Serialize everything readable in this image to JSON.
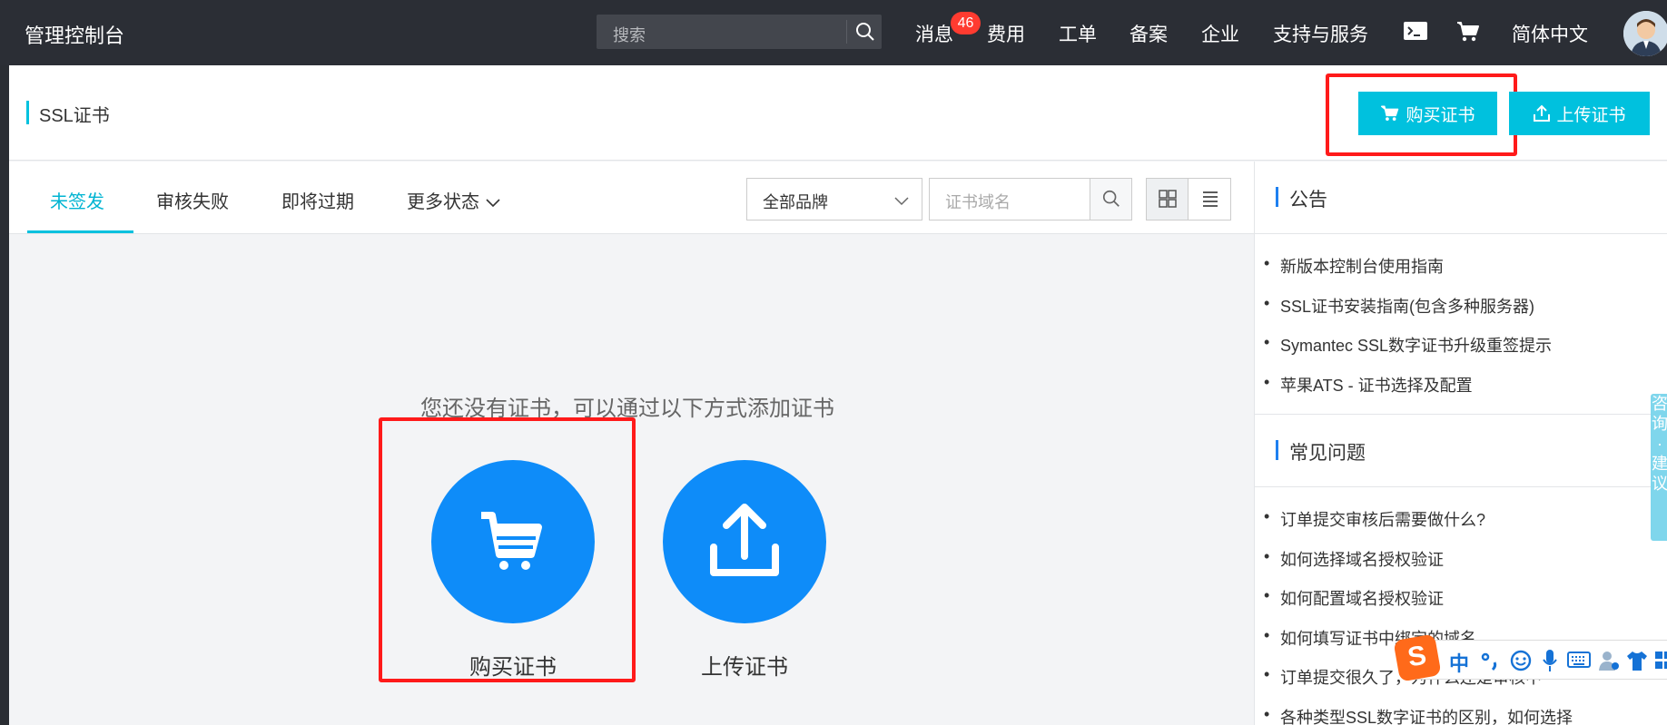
{
  "topbar": {
    "brand": "管理控制台",
    "search_placeholder": "搜索",
    "nav": [
      "消息",
      "费用",
      "工单",
      "备案",
      "企业",
      "支持与服务"
    ],
    "message_badge": "46",
    "language": "简体中文"
  },
  "header": {
    "title": "SSL证书",
    "buy_button": "购买证书",
    "upload_button": "上传证书"
  },
  "tabs": [
    {
      "label": "未签发",
      "active": true
    },
    {
      "label": "审核失败",
      "active": false
    },
    {
      "label": "即将过期",
      "active": false
    },
    {
      "label": "更多状态",
      "active": false
    }
  ],
  "filters": {
    "brand_select": "全部品牌",
    "domain_placeholder": "证书域名"
  },
  "empty_state": {
    "message": "您还没有证书，可以通过以下方式添加证书",
    "buy_label": "购买证书",
    "upload_label": "上传证书"
  },
  "sidebar": {
    "announcements_title": "公告",
    "announcements": [
      "新版本控制台使用指南",
      "SSL证书安装指南(包含多种服务器)",
      "Symantec SSL数字证书升级重签提示",
      "苹果ATS - 证书选择及配置"
    ],
    "faq_title": "常见问题",
    "faq": [
      "订单提交审核后需要做什么?",
      "如何选择域名授权验证",
      "如何配置域名授权验证",
      "如何填写证书中绑定的域名",
      "订单提交很久了，为什么还是审核中",
      "各种类型SSL数字证书的区别，如何选择"
    ]
  },
  "floating": {
    "consult": "咨询·建议",
    "ime_logo": "S",
    "ime_mode": "中"
  },
  "colors": {
    "accent": "#00c1de",
    "primary_blue": "#0e8cf9",
    "highlight_red": "#ff1a1a",
    "topbar_bg": "#2b2e35"
  }
}
